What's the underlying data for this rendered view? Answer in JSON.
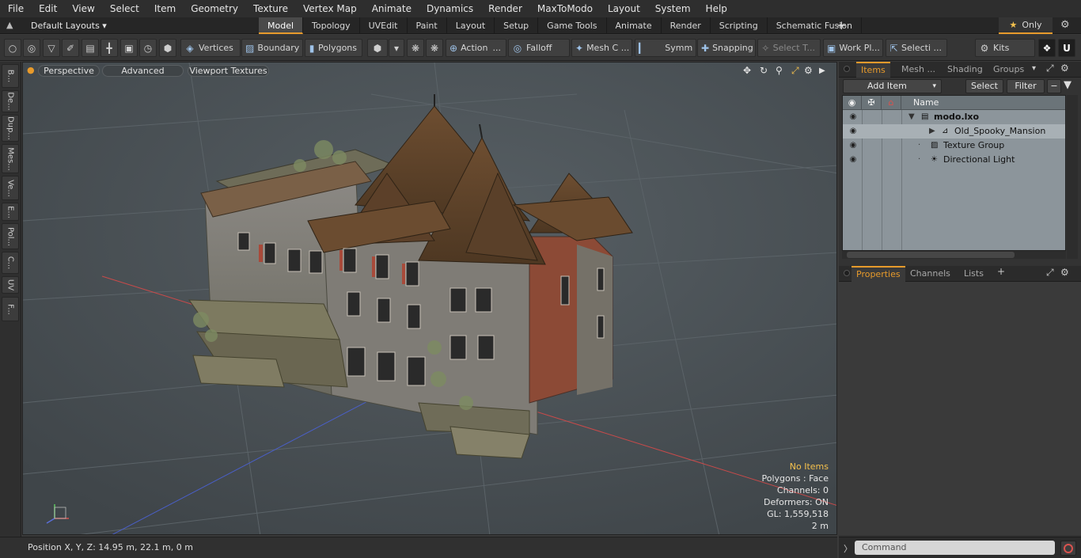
{
  "menu": [
    "File",
    "Edit",
    "View",
    "Select",
    "Item",
    "Geometry",
    "Texture",
    "Vertex Map",
    "Animate",
    "Dynamics",
    "Render",
    "MaxToModo",
    "Layout",
    "System",
    "Help"
  ],
  "layout": {
    "dropdown": "Default Layouts ▾",
    "tabs": [
      "Model",
      "Topology",
      "UVEdit",
      "Paint",
      "Layout",
      "Setup",
      "Game Tools",
      "Animate",
      "Render",
      "Scripting",
      "Schematic Fusion"
    ],
    "active_tab": "Model",
    "plus": "+",
    "only_label": "Only"
  },
  "toolbar": {
    "vertices": "Vertices",
    "boundary": "Boundary",
    "polygons": "Polygons",
    "action": "Action",
    "action_more": "...",
    "falloff": "Falloff",
    "mesh_c": "Mesh C ...",
    "symm": "Symm ...",
    "snapping": "Snapping",
    "select_t": "Select T...",
    "work_pl": "Work Pl...",
    "selecti": "Selecti ...",
    "kits": "Kits"
  },
  "left_strip": [
    "B...",
    "De...",
    "Dup...",
    "Mes...",
    "Ve...",
    "E...",
    "Pol...",
    "C...",
    "UV",
    "F..."
  ],
  "viewport": {
    "perspective": "Perspective",
    "advanced": "Advanced",
    "viewport_textures": "Viewport Textures",
    "hud": {
      "no_items": "No Items",
      "polygons": "Polygons : Face",
      "channels": "Channels: 0",
      "deformers": "Deformers: ON",
      "gl": "GL: 1,559,518",
      "scale": "2 m"
    }
  },
  "status": {
    "position": "Position X, Y, Z:   14.95 m, 22.1 m, 0 m"
  },
  "right_panel": {
    "top_tabs": [
      "Items",
      "Mesh ...",
      "Shading",
      "Groups"
    ],
    "active_top_tab": "Items",
    "add_item": "Add Item",
    "select": "Select",
    "filter": "Filter",
    "list_header_name": "Name",
    "items": [
      {
        "name": "modo.lxo",
        "bold": true,
        "icon": "scene-icon"
      },
      {
        "name": "Old_Spooky_Mansion",
        "bold": false,
        "icon": "mesh-icon"
      },
      {
        "name": "Texture Group",
        "bold": false,
        "icon": "texture-group-icon"
      },
      {
        "name": "Directional Light",
        "bold": false,
        "icon": "light-icon"
      }
    ],
    "bottom_tabs": [
      "Properties",
      "Channels",
      "Lists"
    ],
    "active_bottom_tab": "Properties",
    "bottom_plus": "+",
    "command_placeholder": "Command"
  },
  "colors": {
    "accent": "#e79a2b",
    "viewport_bg": "#4c5357",
    "x_axis": "#c84a4a",
    "z_axis": "#4a5fc8",
    "list_bg": "#8c959b"
  }
}
